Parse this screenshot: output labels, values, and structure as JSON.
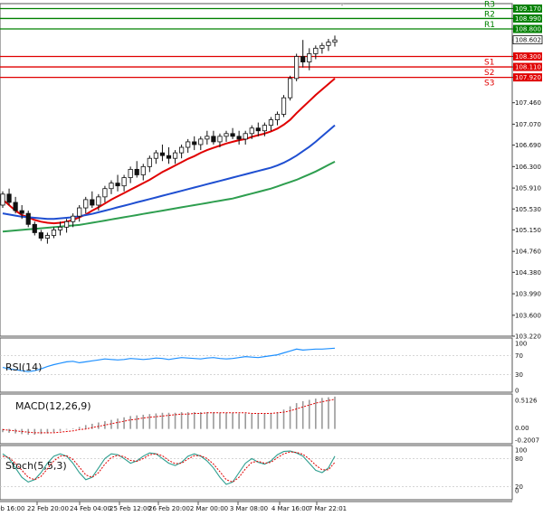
{
  "chart_data": [
    {
      "type": "candlestick",
      "panel": "price",
      "title": "",
      "xlabel": "",
      "ylabel": "",
      "ylim": [
        103.22,
        109.26
      ],
      "y_ticks": [
        "109.170",
        "108.990",
        "108.800",
        "108.602",
        "108.300",
        "108.110",
        "107.920",
        "107.460",
        "107.070",
        "106.690",
        "106.300",
        "105.910",
        "105.530",
        "105.150",
        "104.760",
        "104.380",
        "103.990",
        "103.600",
        "103.220"
      ],
      "x_ticks": [
        "Feb 16:00",
        "22 Feb 20:00",
        "24 Feb 04:00",
        "25 Feb 12:00",
        "26 Feb 20:00",
        "2 Mar 00:00",
        "3 Mar 08:00",
        "4 Mar 16:00",
        "7 Mar 22:01"
      ],
      "current_price": "108.602",
      "levels": [
        {
          "name": "R3",
          "value": 109.17,
          "label": "109.170",
          "color": "#008000"
        },
        {
          "name": "R2",
          "value": 108.99,
          "label": "108.990",
          "color": "#008000"
        },
        {
          "name": "R1",
          "value": 108.8,
          "label": "108.800",
          "color": "#008000"
        },
        {
          "name": "S1",
          "value": 108.3,
          "label": "108.300",
          "color": "#e00000"
        },
        {
          "name": "S2",
          "value": 108.11,
          "label": "108.110",
          "color": "#e00000"
        },
        {
          "name": "S3",
          "value": 107.92,
          "label": "107.920",
          "color": "#e00000"
        }
      ],
      "candles": [
        [
          105.6,
          105.85,
          105.55,
          105.8
        ],
        [
          105.8,
          105.9,
          105.6,
          105.65
        ],
        [
          105.65,
          105.75,
          105.45,
          105.5
        ],
        [
          105.5,
          105.6,
          105.35,
          105.45
        ],
        [
          105.45,
          105.5,
          105.2,
          105.25
        ],
        [
          105.25,
          105.3,
          105.05,
          105.1
        ],
        [
          105.1,
          105.15,
          104.95,
          105.0
        ],
        [
          105.0,
          105.1,
          104.9,
          105.05
        ],
        [
          105.05,
          105.2,
          105.0,
          105.15
        ],
        [
          105.15,
          105.3,
          105.05,
          105.2
        ],
        [
          105.2,
          105.35,
          105.1,
          105.3
        ],
        [
          105.3,
          105.45,
          105.2,
          105.4
        ],
        [
          105.4,
          105.6,
          105.3,
          105.55
        ],
        [
          105.55,
          105.75,
          105.45,
          105.7
        ],
        [
          105.7,
          105.85,
          105.55,
          105.6
        ],
        [
          105.6,
          105.8,
          105.5,
          105.75
        ],
        [
          105.75,
          105.95,
          105.65,
          105.9
        ],
        [
          105.9,
          106.05,
          105.8,
          106.0
        ],
        [
          106.0,
          106.15,
          105.85,
          105.95
        ],
        [
          105.95,
          106.15,
          105.85,
          106.1
        ],
        [
          106.1,
          106.3,
          106.0,
          106.25
        ],
        [
          106.25,
          106.4,
          106.1,
          106.15
        ],
        [
          106.15,
          106.35,
          106.05,
          106.3
        ],
        [
          106.3,
          106.5,
          106.2,
          106.45
        ],
        [
          106.45,
          106.6,
          106.35,
          106.55
        ],
        [
          106.55,
          106.7,
          106.4,
          106.5
        ],
        [
          106.5,
          106.65,
          106.35,
          106.45
        ],
        [
          106.45,
          106.6,
          106.35,
          106.55
        ],
        [
          106.55,
          106.7,
          106.45,
          106.65
        ],
        [
          106.65,
          106.8,
          106.55,
          106.75
        ],
        [
          106.75,
          106.85,
          106.6,
          106.7
        ],
        [
          106.7,
          106.85,
          106.6,
          106.8
        ],
        [
          106.8,
          106.95,
          106.7,
          106.85
        ],
        [
          106.85,
          106.95,
          106.7,
          106.75
        ],
        [
          106.75,
          106.9,
          106.65,
          106.85
        ],
        [
          106.85,
          106.95,
          106.75,
          106.9
        ],
        [
          106.9,
          107.0,
          106.8,
          106.85
        ],
        [
          106.85,
          106.95,
          106.7,
          106.8
        ],
        [
          106.8,
          106.95,
          106.7,
          106.9
        ],
        [
          106.9,
          107.05,
          106.8,
          107.0
        ],
        [
          107.0,
          107.1,
          106.85,
          106.95
        ],
        [
          106.95,
          107.1,
          106.85,
          107.05
        ],
        [
          107.05,
          107.2,
          106.95,
          107.15
        ],
        [
          107.15,
          107.3,
          107.05,
          107.25
        ],
        [
          107.25,
          107.6,
          107.2,
          107.55
        ],
        [
          107.55,
          107.95,
          107.5,
          107.9
        ],
        [
          107.9,
          108.35,
          107.85,
          108.3
        ],
        [
          108.3,
          108.6,
          108.1,
          108.2
        ],
        [
          108.2,
          108.45,
          108.05,
          108.35
        ],
        [
          108.35,
          108.5,
          108.25,
          108.45
        ],
        [
          108.45,
          108.55,
          108.35,
          108.5
        ],
        [
          108.5,
          108.62,
          108.4,
          108.56
        ],
        [
          108.56,
          108.68,
          108.48,
          108.6
        ]
      ],
      "series": [
        {
          "name": "",
          "color": "#e00000",
          "values": [
            105.7,
            105.6,
            105.5,
            105.42,
            105.38,
            105.33,
            105.3,
            105.28,
            105.27,
            105.28,
            105.3,
            105.33,
            105.38,
            105.43,
            105.5,
            105.56,
            105.63,
            105.7,
            105.76,
            105.82,
            105.88,
            105.94,
            106.0,
            106.06,
            106.13,
            106.2,
            106.26,
            106.32,
            106.38,
            106.44,
            106.49,
            106.55,
            106.6,
            106.64,
            106.68,
            106.72,
            106.75,
            106.78,
            106.8,
            106.84,
            106.87,
            106.9,
            106.94,
            106.99,
            107.06,
            107.15,
            107.27,
            107.38,
            107.49,
            107.6,
            107.7,
            107.8,
            107.9
          ]
        },
        {
          "name": "",
          "color": "#1f4fd1",
          "values": [
            105.45,
            105.43,
            105.41,
            105.39,
            105.38,
            105.37,
            105.36,
            105.35,
            105.35,
            105.36,
            105.37,
            105.38,
            105.4,
            105.42,
            105.44,
            105.47,
            105.5,
            105.53,
            105.56,
            105.59,
            105.62,
            105.65,
            105.68,
            105.71,
            105.74,
            105.77,
            105.8,
            105.83,
            105.86,
            105.89,
            105.92,
            105.95,
            105.98,
            106.01,
            106.04,
            106.07,
            106.1,
            106.13,
            106.16,
            106.19,
            106.22,
            106.25,
            106.28,
            106.32,
            106.37,
            106.43,
            106.5,
            106.58,
            106.66,
            106.75,
            106.85,
            106.95,
            107.05
          ]
        },
        {
          "name": "",
          "color": "#2e9e4f",
          "values": [
            105.12,
            105.13,
            105.14,
            105.15,
            105.16,
            105.17,
            105.18,
            105.19,
            105.2,
            105.21,
            105.22,
            105.23,
            105.24,
            105.26,
            105.28,
            105.3,
            105.32,
            105.34,
            105.36,
            105.38,
            105.4,
            105.42,
            105.44,
            105.46,
            105.48,
            105.5,
            105.52,
            105.54,
            105.56,
            105.58,
            105.6,
            105.62,
            105.64,
            105.66,
            105.68,
            105.7,
            105.72,
            105.75,
            105.78,
            105.81,
            105.84,
            105.87,
            105.9,
            105.94,
            105.98,
            106.02,
            106.06,
            106.11,
            106.16,
            106.21,
            106.27,
            106.33,
            106.39
          ]
        }
      ]
    },
    {
      "type": "line",
      "panel": "rsi",
      "title": "RSI(14)",
      "ylim": [
        0,
        100
      ],
      "y_ticks": [
        "100",
        "70",
        "30",
        "0"
      ],
      "series": [
        {
          "name": "RSI(14)",
          "color": "#1e90ff",
          "values": [
            45,
            42,
            40,
            38,
            36,
            38,
            42,
            47,
            51,
            54,
            57,
            58,
            55,
            57,
            59,
            61,
            63,
            62,
            61,
            62,
            64,
            63,
            62,
            63,
            65,
            64,
            62,
            64,
            66,
            65,
            64,
            63,
            65,
            66,
            64,
            63,
            64,
            66,
            68,
            67,
            66,
            68,
            70,
            72,
            76,
            80,
            84,
            82,
            83,
            84,
            84,
            85,
            86
          ]
        }
      ]
    },
    {
      "type": "bar",
      "panel": "macd",
      "title": "MACD(12,26,9)",
      "ylim": [
        -0.2007,
        0.5126
      ],
      "y_ticks": [
        "0.5126",
        "0.00",
        "-0.2007"
      ],
      "series": [
        {
          "name": "MACD(12,26,9)",
          "color": "#9a9a9a",
          "values": [
            -0.05,
            -0.06,
            -0.07,
            -0.08,
            -0.09,
            -0.09,
            -0.08,
            -0.07,
            -0.05,
            -0.03,
            -0.01,
            0.01,
            0.03,
            0.06,
            0.08,
            0.1,
            0.12,
            0.14,
            0.16,
            0.18,
            0.2,
            0.21,
            0.22,
            0.23,
            0.24,
            0.25,
            0.25,
            0.25,
            0.26,
            0.26,
            0.26,
            0.26,
            0.26,
            0.26,
            0.25,
            0.25,
            0.25,
            0.24,
            0.24,
            0.24,
            0.24,
            0.24,
            0.25,
            0.26,
            0.3,
            0.35,
            0.4,
            0.43,
            0.45,
            0.47,
            0.48,
            0.49,
            0.5
          ]
        },
        {
          "name": "Signal",
          "color": "#e00000",
          "values": [
            -0.01,
            -0.02,
            -0.03,
            -0.04,
            -0.05,
            -0.06,
            -0.06,
            -0.06,
            -0.06,
            -0.05,
            -0.04,
            -0.03,
            -0.01,
            0.0,
            0.02,
            0.04,
            0.06,
            0.08,
            0.1,
            0.12,
            0.14,
            0.15,
            0.17,
            0.18,
            0.19,
            0.2,
            0.21,
            0.22,
            0.23,
            0.23,
            0.24,
            0.24,
            0.25,
            0.25,
            0.25,
            0.25,
            0.25,
            0.25,
            0.25,
            0.24,
            0.24,
            0.24,
            0.24,
            0.25,
            0.26,
            0.28,
            0.31,
            0.34,
            0.37,
            0.4,
            0.42,
            0.44,
            0.46
          ]
        }
      ]
    },
    {
      "type": "line",
      "panel": "stoch",
      "title": "Stoch(5,5,3)",
      "ylim": [
        0,
        100
      ],
      "y_ticks": [
        "100",
        "80",
        "20",
        "0"
      ],
      "series": [
        {
          "name": "Stoch(5,5,3)",
          "color": "#2e9e8f",
          "values": [
            90,
            80,
            60,
            40,
            30,
            35,
            50,
            70,
            85,
            90,
            85,
            70,
            50,
            35,
            40,
            60,
            80,
            90,
            88,
            80,
            70,
            75,
            85,
            92,
            90,
            80,
            70,
            65,
            72,
            85,
            90,
            85,
            75,
            60,
            40,
            25,
            30,
            50,
            70,
            80,
            72,
            68,
            75,
            88,
            95,
            96,
            92,
            85,
            70,
            55,
            50,
            60,
            85
          ]
        },
        {
          "name": "",
          "color": "#e00000",
          "values": [
            85,
            82,
            70,
            55,
            40,
            35,
            42,
            58,
            75,
            85,
            86,
            78,
            62,
            45,
            40,
            50,
            68,
            82,
            87,
            84,
            76,
            74,
            80,
            88,
            90,
            86,
            76,
            69,
            70,
            79,
            86,
            86,
            80,
            68,
            52,
            35,
            30,
            40,
            58,
            72,
            74,
            70,
            72,
            82,
            90,
            94,
            93,
            89,
            79,
            66,
            56,
            56,
            72
          ]
        }
      ]
    }
  ]
}
